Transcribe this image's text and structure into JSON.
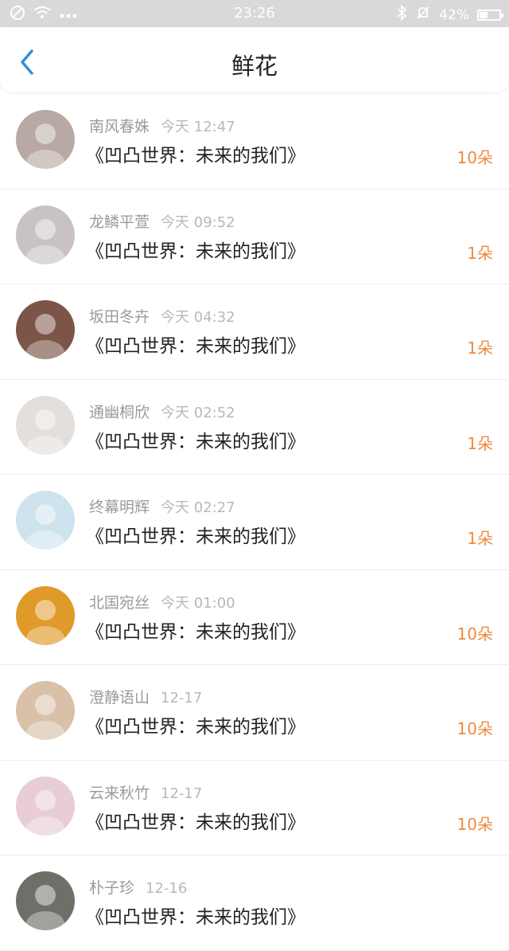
{
  "status_bar": {
    "time": "23:26",
    "battery": "42%",
    "battery_level": 0.42
  },
  "header": {
    "title": "鲜花"
  },
  "items": [
    {
      "name": "南风春姝",
      "time": "今天 12:47",
      "book": "《凹凸世界：未来的我们》",
      "count": "10朵",
      "avatar_color": "#b8a9a4"
    },
    {
      "name": "龙鳞平萱",
      "time": "今天 09:52",
      "book": "《凹凸世界：未来的我们》",
      "count": "1朵",
      "avatar_color": "#c8c2c7"
    },
    {
      "name": "坂田冬卉",
      "time": "今天 04:32",
      "book": "《凹凸世界：未来的我们》",
      "count": "1朵",
      "avatar_color": "#7c5548"
    },
    {
      "name": "通幽桐欣",
      "time": "今天 02:52",
      "book": "《凹凸世界：未来的我们》",
      "count": "1朵",
      "avatar_color": "#e3dfdc"
    },
    {
      "name": "终幕明辉",
      "time": "今天 02:27",
      "book": "《凹凸世界：未来的我们》",
      "count": "1朵",
      "avatar_color": "#cfe3ee"
    },
    {
      "name": "北国宛丝",
      "time": "今天 01:00",
      "book": "《凹凸世界：未来的我们》",
      "count": "10朵",
      "avatar_color": "#e09a2a"
    },
    {
      "name": "澄静语山",
      "time": "12-17",
      "book": "《凹凸世界：未来的我们》",
      "count": "10朵",
      "avatar_color": "#d9c0a8"
    },
    {
      "name": "云来秋竹",
      "time": "12-17",
      "book": "《凹凸世界：未来的我们》",
      "count": "10朵",
      "avatar_color": "#e8cdd6"
    },
    {
      "name": "朴子珍",
      "time": "12-16",
      "book": "《凹凸世界：未来的我们》",
      "count": "",
      "avatar_color": "#6f6f6a"
    }
  ]
}
